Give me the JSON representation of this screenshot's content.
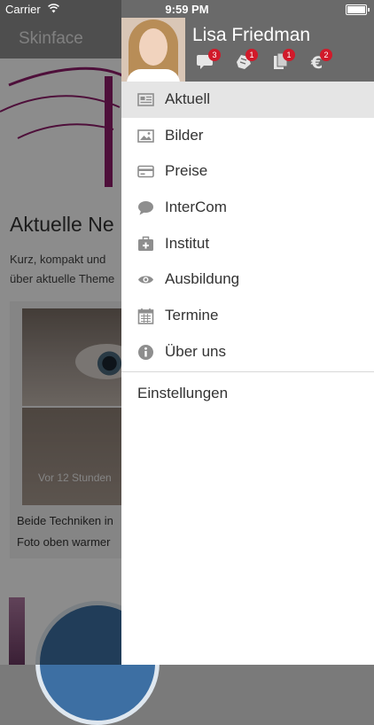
{
  "status_bar": {
    "carrier": "Carrier",
    "time": "9:59 PM"
  },
  "background_app": {
    "title": "Skinface",
    "heading": "Aktuelle Ne",
    "intro": [
      "Kurz, kompakt und",
      "über aktuelle Theme"
    ],
    "card": {
      "time_label": "Vor 12 Stunden",
      "text": [
        "Beide Techniken in",
        "Foto oben warmer"
      ]
    }
  },
  "drawer": {
    "user_name": "Lisa Friedman",
    "header_icons": [
      {
        "icon": "chat-icon",
        "badge": "3"
      },
      {
        "icon": "hand-icon",
        "badge": "1"
      },
      {
        "icon": "documents-icon",
        "badge": "1"
      },
      {
        "icon": "euro-icon",
        "badge": "2"
      }
    ],
    "menu": [
      {
        "icon": "news-icon",
        "label": "Aktuell",
        "active": true
      },
      {
        "icon": "image-icon",
        "label": "Bilder"
      },
      {
        "icon": "credit-card-icon",
        "label": "Preise"
      },
      {
        "icon": "speech-bubble-icon",
        "label": "InterCom"
      },
      {
        "icon": "first-aid-icon",
        "label": "Institut"
      },
      {
        "icon": "eye-icon",
        "label": "Ausbildung"
      },
      {
        "icon": "calendar-icon",
        "label": "Termine"
      },
      {
        "icon": "info-icon",
        "label": "Über uns"
      }
    ],
    "settings_label": "Einstellungen"
  },
  "colors": {
    "drawer_header": "#6a6a6a",
    "active_item": "#e5e5e5",
    "badge": "#d11a2a",
    "icon_gray": "#8e8e8e",
    "brand_magenta": "#8e1d6b"
  }
}
